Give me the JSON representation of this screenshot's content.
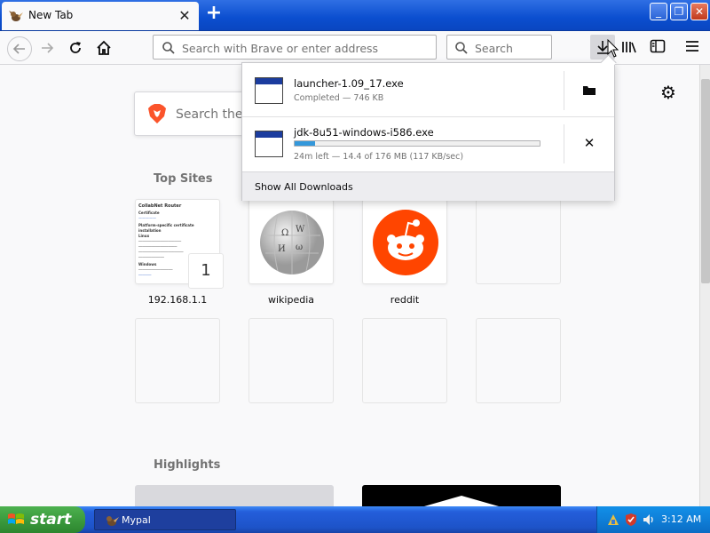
{
  "window": {
    "tab_title": "New Tab",
    "new_tab_label": "+",
    "tab_close_label": "✕",
    "minimize_label": "_",
    "maximize_label": "❐",
    "close_label": "✕"
  },
  "navbar": {
    "url_placeholder": "Search with Brave or enter address",
    "search_placeholder": "Search",
    "icons": [
      "back-arrow-icon",
      "forward-arrow-icon",
      "reload-icon",
      "home-icon",
      "search-icon",
      "download-icon",
      "library-icon",
      "sidebar-icon",
      "hamburger-menu-icon"
    ]
  },
  "newtab": {
    "search_placeholder": "Search the",
    "top_sites_title": "Top Sites",
    "highlights_title": "Highlights",
    "top_sites": [
      {
        "label": "192.168.1.1",
        "badge": "1"
      },
      {
        "label": "wikipedia"
      },
      {
        "label": "reddit"
      }
    ],
    "router_preview": {
      "heading": "CollabNet Router",
      "subheading": "Certificate",
      "section": "Platform-specific certificate installation",
      "section2": "Linux",
      "section3": "Windows"
    }
  },
  "downloads": {
    "items": [
      {
        "name": "launcher-1.09_17.exe",
        "status": "Completed — 746 KB",
        "action_icon": "folder-icon",
        "action_label": "▬"
      },
      {
        "name": "jdk-8u51-windows-i586.exe",
        "status": "24m left — 14.4 of 176 MB (117 KB/sec)",
        "action_icon": "cancel-icon",
        "action_label": "✕",
        "progress_fraction": 0.082
      }
    ],
    "footer_label": "Show All Downloads"
  },
  "taskbar": {
    "start_label": "start",
    "task_label": "Mypal",
    "clock": "3:12 AM"
  },
  "colors": {
    "xp_blue": "#245edb",
    "start_green": "#3c9b3e",
    "progress_blue": "#3498db",
    "reddit_orange": "#ff4500",
    "brave_orange": "#fb542b"
  }
}
